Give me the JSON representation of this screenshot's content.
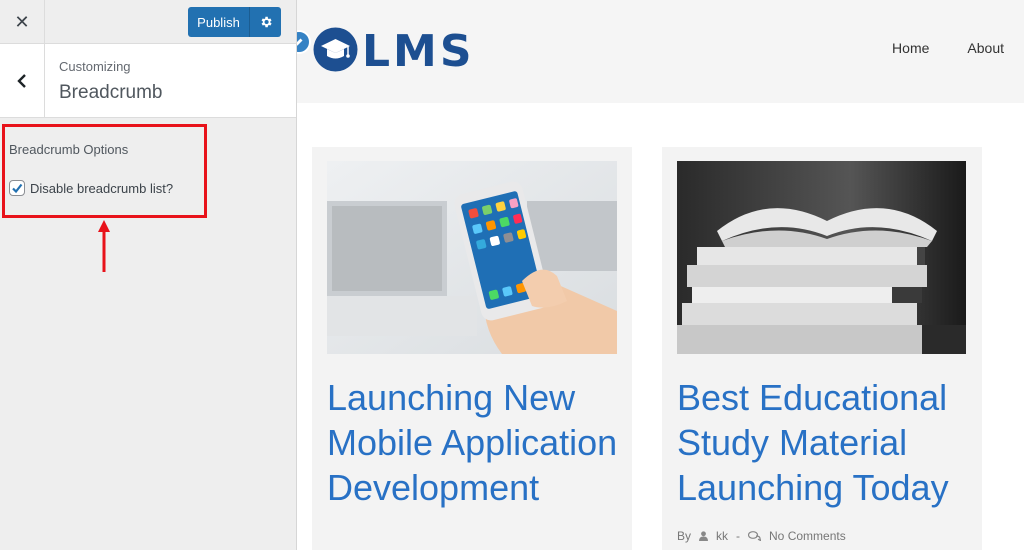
{
  "topbar": {
    "publish_label": "Publish"
  },
  "section": {
    "customizing": "Customizing",
    "title": "Breadcrumb"
  },
  "options": {
    "heading": "Breadcrumb Options",
    "checkbox_label": "Disable breadcrumb list?",
    "checked": true
  },
  "site": {
    "logo_text": "LMS",
    "nav": [
      "Home",
      "About"
    ]
  },
  "posts": [
    {
      "title": "Launching New Mobile Application Development"
    },
    {
      "title": "Best Educational Study Material Launching Today",
      "meta": {
        "by": "By",
        "author": "kk",
        "separator": "-",
        "comments": "No Comments"
      }
    }
  ],
  "colors": {
    "accent": "#2271b1",
    "highlight": "#e8121a",
    "title_blue": "#2871c5",
    "logo_blue": "#1d4f91"
  }
}
